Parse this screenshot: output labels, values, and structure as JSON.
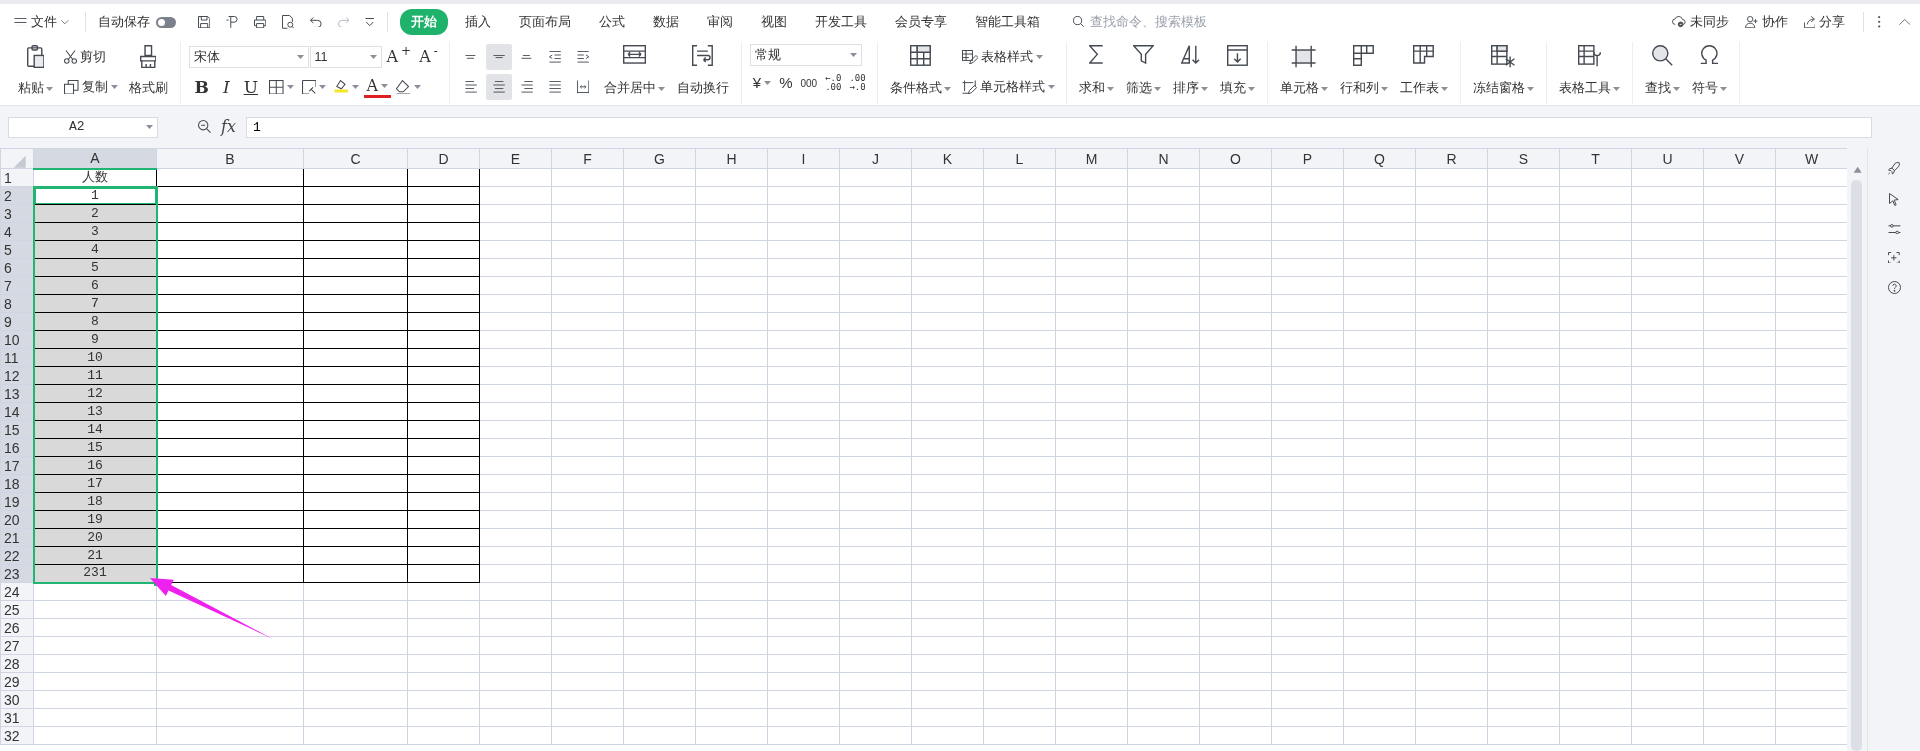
{
  "menu": {
    "label": "文件"
  },
  "autosave": {
    "label": "自动保存",
    "on": false
  },
  "tabs": [
    {
      "label": "开始",
      "selected": true
    },
    {
      "label": "插入",
      "selected": false
    },
    {
      "label": "页面布局",
      "selected": false
    },
    {
      "label": "公式",
      "selected": false
    },
    {
      "label": "数据",
      "selected": false
    },
    {
      "label": "审阅",
      "selected": false
    },
    {
      "label": "视图",
      "selected": false
    },
    {
      "label": "开发工具",
      "selected": false
    },
    {
      "label": "会员专享",
      "selected": false
    },
    {
      "label": "智能工具箱",
      "selected": false
    }
  ],
  "command_search": {
    "placeholder": "查找命令、搜索模板"
  },
  "account_actions": [
    {
      "label": "未同步"
    },
    {
      "label": "协作"
    },
    {
      "label": "分享"
    }
  ],
  "ribbon": [
    {
      "kind": "clipboard",
      "items": [
        {
          "label": "粘贴",
          "dropdown": true
        },
        {
          "label": "剪切",
          "dropdown": false
        },
        {
          "label": "复制",
          "dropdown": true
        },
        {
          "label": "格式刷",
          "dropdown": false
        }
      ]
    },
    {
      "kind": "font",
      "font_name": "宋体",
      "font_size": "11",
      "size_buttons": [
        {
          "label": "A$^{+}$"
        },
        {
          "label": "A$^{-}$"
        }
      ],
      "format_buttons": [
        {
          "kind": "text",
          "label": "B",
          "dropdown": false
        },
        {
          "kind": "text",
          "label": "I",
          "dropdown": false
        },
        {
          "kind": "text",
          "label": "U",
          "dropdown": false
        },
        {
          "kind": "icon",
          "dropdown": true
        },
        {
          "kind": "icon",
          "dropdown": true
        },
        {
          "kind": "icon",
          "dropdown": true
        },
        {
          "kind": "color",
          "label": "A",
          "dropdown": true
        },
        {
          "kind": "icon",
          "dropdown": true
        }
      ]
    },
    {
      "kind": "alignment",
      "buttons": [
        {
          "selected": false
        },
        {
          "selected": true
        },
        {
          "selected": false
        },
        {
          "selected": false
        },
        {
          "selected": false
        },
        {
          "selected": false
        },
        {
          "selected": true
        },
        {
          "selected": false
        },
        {
          "selected": false
        },
        {
          "selected": false
        }
      ],
      "items": [
        {
          "label": "合并居中",
          "dropdown": true
        },
        {
          "label": "自动换行",
          "dropdown": false
        }
      ]
    },
    {
      "kind": "number",
      "format": "常规",
      "buttons": [
        {
          "label": "¥",
          "dropdown": true
        },
        {
          "label": "%",
          "dropdown": false
        },
        {
          "label": "000",
          "dropdown": false
        },
        {
          "top": "←.0",
          "bottom": ".00",
          "dropdown": false
        },
        {
          "top": ".00",
          "bottom": "→.0",
          "dropdown": false
        }
      ]
    },
    {
      "kind": "styles",
      "items": [
        {
          "label": "条件格式",
          "dropdown": true
        },
        {
          "label": "表格样式",
          "dropdown": true
        },
        {
          "label": "单元格样式",
          "dropdown": true
        }
      ]
    },
    {
      "kind": "large",
      "items": [
        {
          "label": "求和",
          "dropdown": true
        },
        {
          "label": "筛选",
          "dropdown": true
        },
        {
          "label": "排序",
          "dropdown": true
        },
        {
          "label": "填充",
          "dropdown": true
        }
      ]
    },
    {
      "kind": "large",
      "items": [
        {
          "label": "单元格",
          "dropdown": true
        },
        {
          "label": "行和列",
          "dropdown": true
        },
        {
          "label": "工作表",
          "dropdown": true
        }
      ]
    },
    {
      "kind": "large",
      "items": [
        {
          "label": "冻结窗格",
          "dropdown": true
        }
      ]
    },
    {
      "kind": "large",
      "items": [
        {
          "label": "表格工具",
          "dropdown": true
        }
      ]
    },
    {
      "kind": "large",
      "items": [
        {
          "label": "查找",
          "dropdown": true
        },
        {
          "label": "符号",
          "dropdown": true
        }
      ]
    }
  ],
  "formula_bar": {
    "cell_ref": "A2",
    "function_label": "fx",
    "formula": "1"
  },
  "columns": [
    {
      "label": "A",
      "selected": true
    },
    {
      "label": "B",
      "selected": false
    },
    {
      "label": "C",
      "selected": false
    },
    {
      "label": "D",
      "selected": false
    },
    {
      "label": "E",
      "selected": false
    },
    {
      "label": "F",
      "selected": false
    },
    {
      "label": "G",
      "selected": false
    },
    {
      "label": "H",
      "selected": false
    },
    {
      "label": "I",
      "selected": false
    },
    {
      "label": "J",
      "selected": false
    },
    {
      "label": "K",
      "selected": false
    },
    {
      "label": "L",
      "selected": false
    },
    {
      "label": "M",
      "selected": false
    },
    {
      "label": "N",
      "selected": false
    },
    {
      "label": "O",
      "selected": false
    },
    {
      "label": "P",
      "selected": false
    },
    {
      "label": "Q",
      "selected": false
    },
    {
      "label": "R",
      "selected": false
    },
    {
      "label": "S",
      "selected": false
    },
    {
      "label": "T",
      "selected": false
    },
    {
      "label": "U",
      "selected": false
    },
    {
      "label": "V",
      "selected": false
    },
    {
      "label": "W",
      "selected": false
    }
  ],
  "rows": [
    {
      "label": "1",
      "value": "人数",
      "bordered": true,
      "selected": false,
      "active": false
    },
    {
      "label": "2",
      "value": "1",
      "bordered": true,
      "selected": true,
      "active": true
    },
    {
      "label": "3",
      "value": "2",
      "bordered": true,
      "selected": true,
      "active": false
    },
    {
      "label": "4",
      "value": "3",
      "bordered": true,
      "selected": true,
      "active": false
    },
    {
      "label": "5",
      "value": "4",
      "bordered": true,
      "selected": true,
      "active": false
    },
    {
      "label": "6",
      "value": "5",
      "bordered": true,
      "selected": true,
      "active": false
    },
    {
      "label": "7",
      "value": "6",
      "bordered": true,
      "selected": true,
      "active": false
    },
    {
      "label": "8",
      "value": "7",
      "bordered": true,
      "selected": true,
      "active": false
    },
    {
      "label": "9",
      "value": "8",
      "bordered": true,
      "selected": true,
      "active": false
    },
    {
      "label": "10",
      "value": "9",
      "bordered": true,
      "selected": true,
      "active": false
    },
    {
      "label": "11",
      "value": "10",
      "bordered": true,
      "selected": true,
      "active": false
    },
    {
      "label": "12",
      "value": "11",
      "bordered": true,
      "selected": true,
      "active": false
    },
    {
      "label": "13",
      "value": "12",
      "bordered": true,
      "selected": true,
      "active": false
    },
    {
      "label": "14",
      "value": "13",
      "bordered": true,
      "selected": true,
      "active": false
    },
    {
      "label": "15",
      "value": "14",
      "bordered": true,
      "selected": true,
      "active": false
    },
    {
      "label": "16",
      "value": "15",
      "bordered": true,
      "selected": true,
      "active": false
    },
    {
      "label": "17",
      "value": "16",
      "bordered": true,
      "selected": true,
      "active": false
    },
    {
      "label": "18",
      "value": "17",
      "bordered": true,
      "selected": true,
      "active": false
    },
    {
      "label": "19",
      "value": "18",
      "bordered": true,
      "selected": true,
      "active": false
    },
    {
      "label": "20",
      "value": "19",
      "bordered": true,
      "selected": true,
      "active": false
    },
    {
      "label": "21",
      "value": "20",
      "bordered": true,
      "selected": true,
      "active": false
    },
    {
      "label": "22",
      "value": "21",
      "bordered": true,
      "selected": true,
      "active": false
    },
    {
      "label": "23",
      "value": "231",
      "bordered": true,
      "selected": true,
      "active": false
    },
    {
      "label": "24",
      "bordered": false,
      "selected": false,
      "active": false
    },
    {
      "label": "25",
      "bordered": false,
      "selected": false,
      "active": false
    },
    {
      "label": "26",
      "bordered": false,
      "selected": false,
      "active": false
    },
    {
      "label": "27",
      "bordered": false,
      "selected": false,
      "active": false
    },
    {
      "label": "28",
      "bordered": false,
      "selected": false,
      "active": false
    },
    {
      "label": "29",
      "bordered": false,
      "selected": false,
      "active": false
    },
    {
      "label": "30",
      "bordered": false,
      "selected": false,
      "active": false
    },
    {
      "label": "31",
      "bordered": false,
      "selected": false,
      "active": false
    },
    {
      "label": "32",
      "bordered": false,
      "selected": false,
      "active": false
    }
  ]
}
